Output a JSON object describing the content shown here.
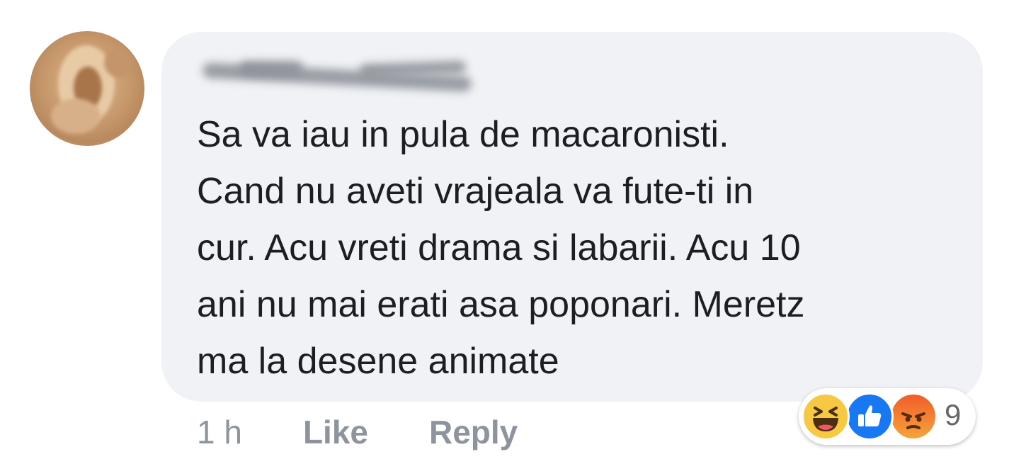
{
  "comment": {
    "text": "Sa va iau in pula de macaronisti.\nCand nu aveti vrajeala va fute-ti in\ncur. Acu vreti drama si labarii. Acu 10\nani nu mai erati asa poponari. Meretz\nma la desene animate",
    "timestamp": "1 h",
    "like_label": "Like",
    "reply_label": "Reply"
  },
  "reactions": {
    "types": [
      "haha-icon",
      "like-icon",
      "angry-icon"
    ],
    "count": "9"
  },
  "colors": {
    "bubble": "#f0f2f5",
    "text": "#1c1e21",
    "meta": "#8d949e",
    "like_blue": "#1877f2",
    "haha_yellow": "#f7c842",
    "angry_orange": "#f25d2a"
  }
}
